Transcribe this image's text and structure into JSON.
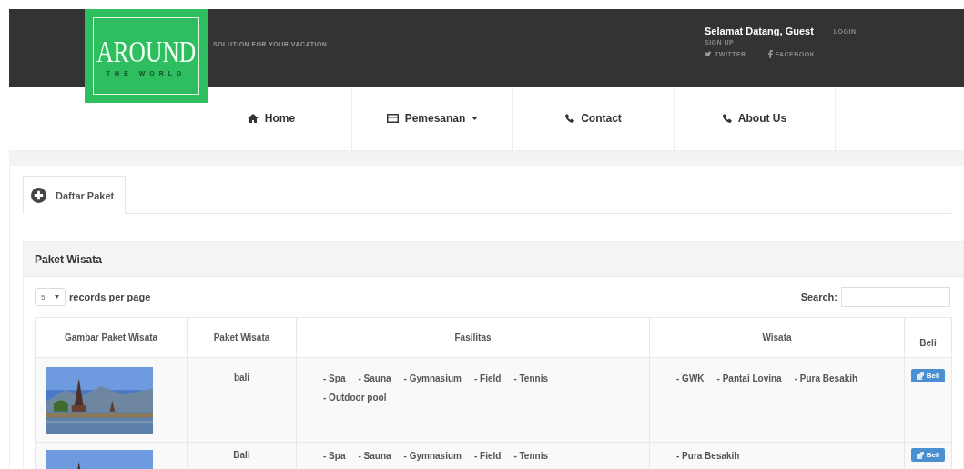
{
  "header": {
    "logo": {
      "title": "AROUND",
      "subtitle": "THE WORLD"
    },
    "tagline": "SOLUTION FOR YOUR VACATION",
    "welcome": "Selamat Datang, Guest",
    "login": "LOGIN",
    "signup": "SIGN UP",
    "social": [
      {
        "kind": "twitter",
        "label": "TWITTER"
      },
      {
        "kind": "facebook",
        "label": "FACEBOOK"
      }
    ]
  },
  "nav": [
    {
      "kind": "home",
      "label": "Home",
      "dropdown": false
    },
    {
      "kind": "card",
      "label": "Pemesanan",
      "dropdown": true
    },
    {
      "kind": "phone",
      "label": "Contact",
      "dropdown": false
    },
    {
      "kind": "phone",
      "label": "About Us",
      "dropdown": false
    }
  ],
  "tabs": [
    {
      "label": "Daftar Paket",
      "selected": true
    }
  ],
  "panel": {
    "title": "Paket Wisata",
    "page_size": "5",
    "records_label": "records per page",
    "search_label": "Search:"
  },
  "table": {
    "columns": [
      "Gambar Paket Wisata",
      "Paket Wisata",
      "Fasilitas",
      "Wisata",
      "Beli"
    ],
    "rows": [
      {
        "image": {
          "kind": "picture"
        },
        "name": "bali",
        "facilities": [
          "- Spa",
          "- Sauna",
          "- Gymnasium",
          "- Field",
          "- Tennis",
          "- Outdoor pool"
        ],
        "sights": [
          "- GWK",
          "- Pantai Lovina",
          "- Pura Besakih"
        ],
        "button": "Beli"
      },
      {
        "image": {
          "kind": "picture"
        },
        "name": "Bali",
        "facilities": [
          "- Spa",
          "- Sauna",
          "- Gymnasium",
          "- Field",
          "- Tennis"
        ],
        "sights": [
          "- Pura Besakih"
        ],
        "button": "Beli"
      }
    ]
  }
}
